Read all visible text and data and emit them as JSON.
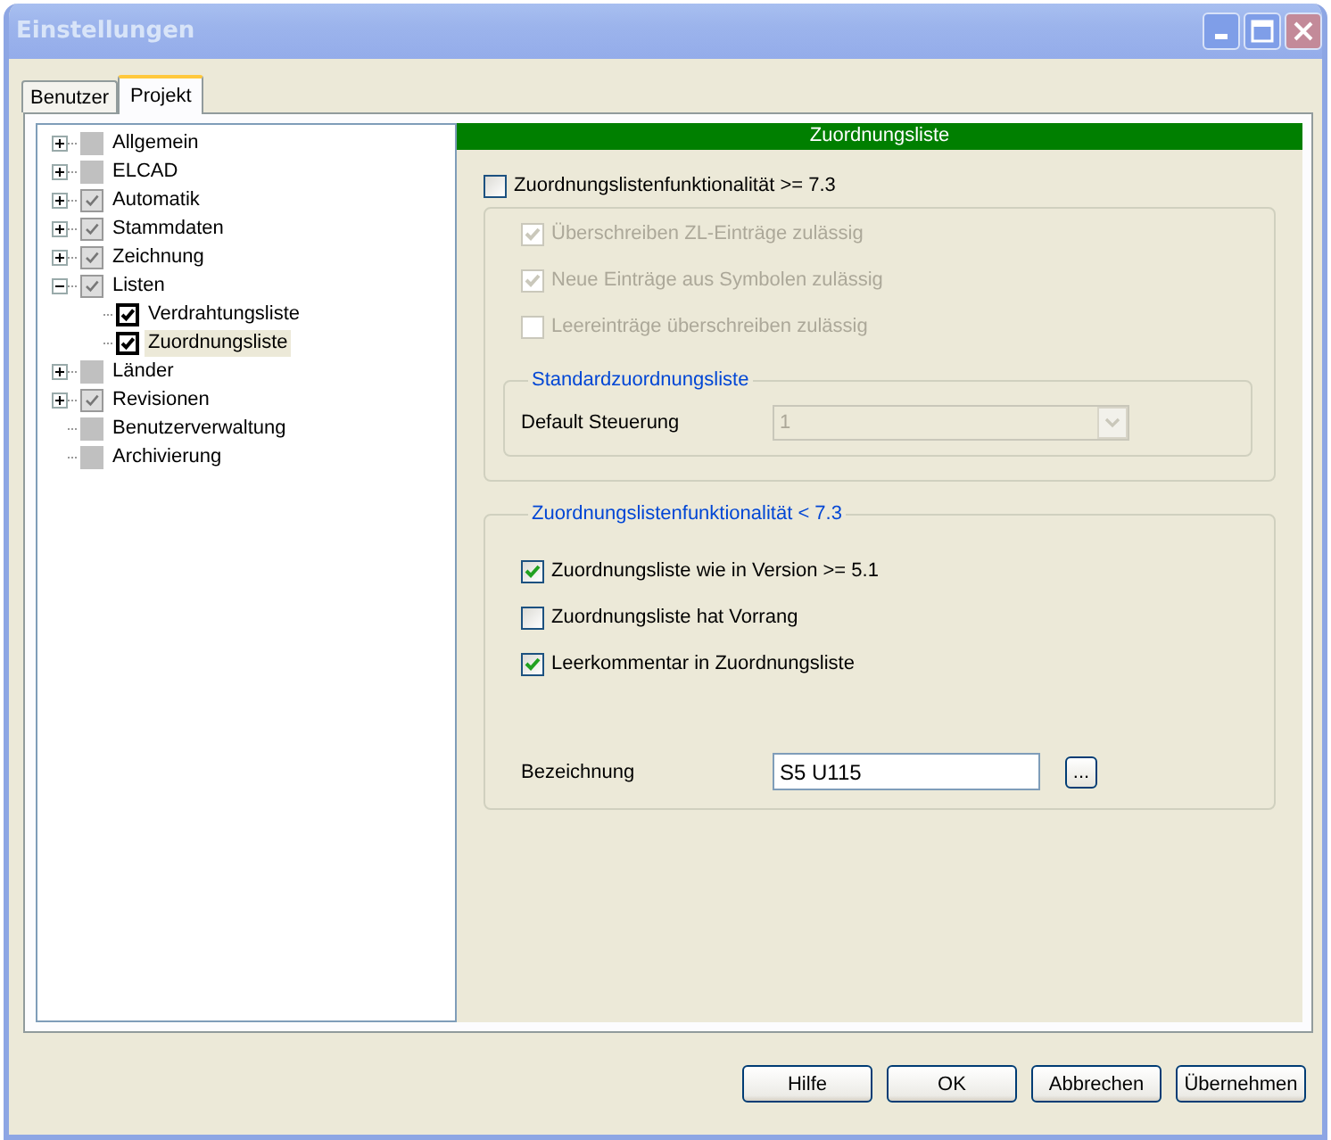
{
  "window": {
    "title": "Einstellungen"
  },
  "tabs": [
    {
      "label": "Benutzer",
      "selected": false
    },
    {
      "label": "Projekt",
      "selected": true
    }
  ],
  "tree": [
    {
      "label": "Allgemein",
      "expanded": false,
      "checked": false,
      "kind": "inherited",
      "selected": false
    },
    {
      "label": "ELCAD",
      "expanded": false,
      "checked": false,
      "kind": "inherited",
      "selected": false
    },
    {
      "label": "Automatik",
      "expanded": false,
      "checked": true,
      "kind": "inherited",
      "selected": false
    },
    {
      "label": "Stammdaten",
      "expanded": false,
      "checked": true,
      "kind": "inherited",
      "selected": false
    },
    {
      "label": "Zeichnung",
      "expanded": false,
      "checked": true,
      "kind": "inherited",
      "selected": false
    },
    {
      "label": "Listen",
      "expanded": true,
      "checked": true,
      "kind": "inherited",
      "selected": false,
      "children": [
        {
          "label": "Verdrahtungsliste",
          "checked": true,
          "kind": "own",
          "selected": false
        },
        {
          "label": "Zuordnungsliste",
          "checked": true,
          "kind": "own",
          "selected": true
        }
      ]
    },
    {
      "label": "Länder",
      "expanded": false,
      "checked": false,
      "kind": "inherited",
      "selected": false
    },
    {
      "label": "Revisionen",
      "expanded": false,
      "checked": true,
      "kind": "inherited",
      "selected": false
    },
    {
      "label": "Benutzerverwaltung",
      "checked": false,
      "kind": "inherited",
      "selected": false
    },
    {
      "label": "Archivierung",
      "checked": false,
      "kind": "inherited",
      "selected": false
    }
  ],
  "panel": {
    "header": "Zuordnungsliste",
    "main_option": {
      "label": "Zuordnungslistenfunktionalität >= 7.3",
      "checked": false
    },
    "group_new": {
      "disabled": true,
      "options": [
        {
          "label": "Überschreiben ZL-Einträge zulässig",
          "checked": true
        },
        {
          "label": "Neue Einträge aus Symbolen zulässig",
          "checked": true
        },
        {
          "label": "Leereinträge überschreiben zulässig",
          "checked": false
        }
      ],
      "subgroup": {
        "title": "Standardzuordnungsliste",
        "field_label": "Default Steuerung",
        "value": "1"
      }
    },
    "group_old": {
      "title": "Zuordnungslistenfunktionalität < 7.3",
      "options": [
        {
          "label": "Zuordnungsliste wie in Version >= 5.1",
          "checked": true
        },
        {
          "label": "Zuordnungsliste hat Vorrang",
          "checked": false
        },
        {
          "label": "Leerkommentar in Zuordnungsliste",
          "checked": true
        }
      ],
      "field_label": "Bezeichnung",
      "value": "S5 U115",
      "browse_button": "..."
    }
  },
  "buttons": [
    "Hilfe",
    "OK",
    "Abbrechen",
    "Übernehmen"
  ]
}
